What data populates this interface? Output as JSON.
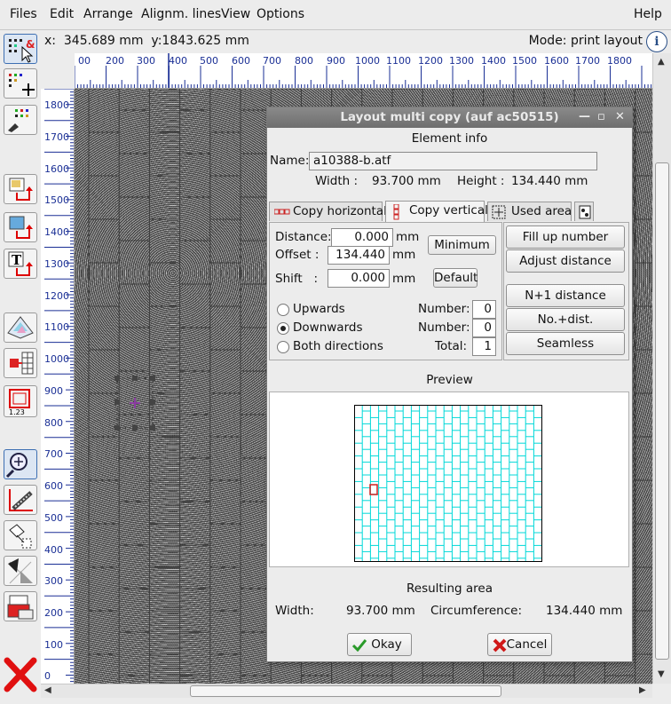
{
  "menu": {
    "files": "Files",
    "edit": "Edit",
    "arrange": "Arrange",
    "align": "Alignm. lines",
    "view": "View",
    "options": "Options",
    "help": "Help"
  },
  "status": {
    "coords": "x:  345.689 mm  y:1843.625 mm",
    "mode": "Mode: print layout",
    "info": "i"
  },
  "ruler_top": [
    "00",
    "200",
    "300",
    "400",
    "500",
    "600",
    "700",
    "800",
    "900",
    "1000",
    "1100",
    "1200",
    "1300",
    "1400",
    "1500",
    "1600",
    "1700",
    "1800"
  ],
  "ruler_left": [
    "1800",
    "1700",
    "1600",
    "1500",
    "1400",
    "1300",
    "1200",
    "1100",
    "1000",
    "900",
    "800",
    "700",
    "600",
    "500",
    "400",
    "300",
    "200",
    "100",
    "0"
  ],
  "dialog": {
    "title": "Layout multi copy (auf ac50515)",
    "element_info": "Element info",
    "name_label": "Name:",
    "name_value": "a10388-b.atf",
    "width_label": "Width :",
    "width_value": "93.700 mm",
    "height_label": "Height :",
    "height_value": "134.440 mm",
    "tabs": [
      "Copy horizontal",
      "Copy vertical",
      "Used area"
    ],
    "active_tab": "Copy vertical",
    "distance_label": "Distance:",
    "distance_value": "0.000",
    "offset_label": "Offset  :",
    "offset_value": "134.440",
    "shift_label": "Shift   :",
    "shift_value": "0.000",
    "unit": "mm",
    "minimum": "Minimum",
    "default": "Default",
    "fill_up": "Fill up number",
    "adjust": "Adjust distance",
    "n1": "N+1 distance",
    "no_dist": "No.+dist.",
    "seamless": "Seamless",
    "upwards": "Upwards",
    "downwards": "Downwards",
    "both": "Both directions",
    "selected_direction": "Downwards",
    "number_label": "Number:",
    "number_up": "0",
    "number_down": "0",
    "total_label": "Total:",
    "total": "1",
    "preview": "Preview",
    "resulting": "Resulting area",
    "res_width_label": "Width:",
    "res_width": "93.700 mm",
    "circ_label": "Circumference:",
    "circ": "134.440 mm",
    "ok": "Okay",
    "cancel": "Cancel"
  },
  "colors": {
    "preview_grid": "#00d8d8",
    "preview_frame": "#000000",
    "title_bar": "#7a7a7a"
  }
}
